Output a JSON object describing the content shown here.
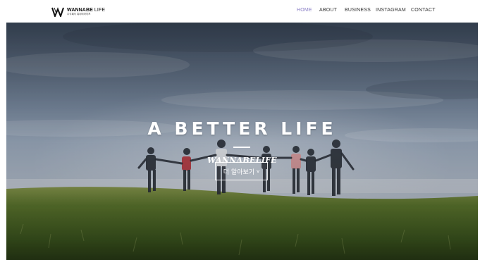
{
  "header": {
    "logo": {
      "title_bold": "WANNABE",
      "title_light": " LIFE",
      "subtitle": "주식회사 워너비라이프"
    },
    "nav": [
      {
        "label": "HOME",
        "active": true
      },
      {
        "label": "ABOUT",
        "active": false
      },
      {
        "label": "BUSINESS",
        "active": false
      },
      {
        "label": "INSTAGRAM",
        "active": false
      },
      {
        "label": "CONTACT",
        "active": false
      }
    ]
  },
  "hero": {
    "title": "A BETTER LIFE",
    "subtitle": "WANNABELIFE",
    "cta_label": "더 알아보기",
    "cta_icon": "chevron-down-icon",
    "cta_chevron": "v"
  },
  "colors": {
    "nav_active": "#8a7fc6",
    "nav_text": "#333333",
    "hero_text": "#ffffff"
  }
}
